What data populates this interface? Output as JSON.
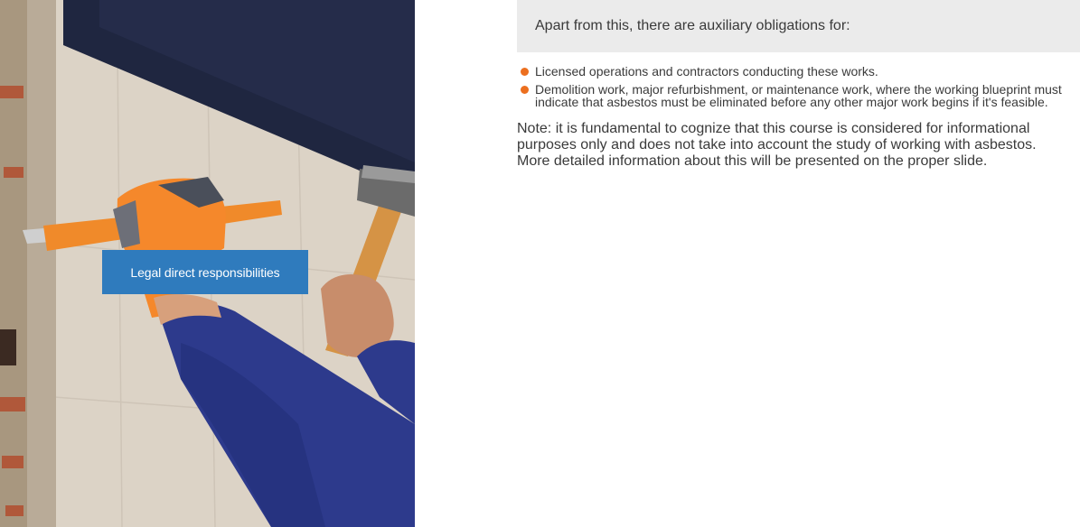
{
  "left_panel": {
    "photo_alt": "worker-chiseling-wall-photo",
    "button_label": "Legal direct responsibilities"
  },
  "content": {
    "intro": "Apart from this, there are auxiliary obligations for:",
    "bullets": [
      "Licensed operations and contractors conducting these works.",
      "Demolition work, major refurbishment, or maintenance work, where the working blueprint must indicate that asbestos must be eliminated before any other major work begins if it's feasible."
    ],
    "note": "Note: it is fundamental to cognize that this course is considered for informational purposes only and does not take into account the study of working with asbestos. More detailed information about this will be presented on the proper slide."
  },
  "colors": {
    "button_bg": "#2f7bbd",
    "bullet": "#ec6f1f",
    "intro_bg": "#ebebeb",
    "text": "#3a3a3a"
  }
}
